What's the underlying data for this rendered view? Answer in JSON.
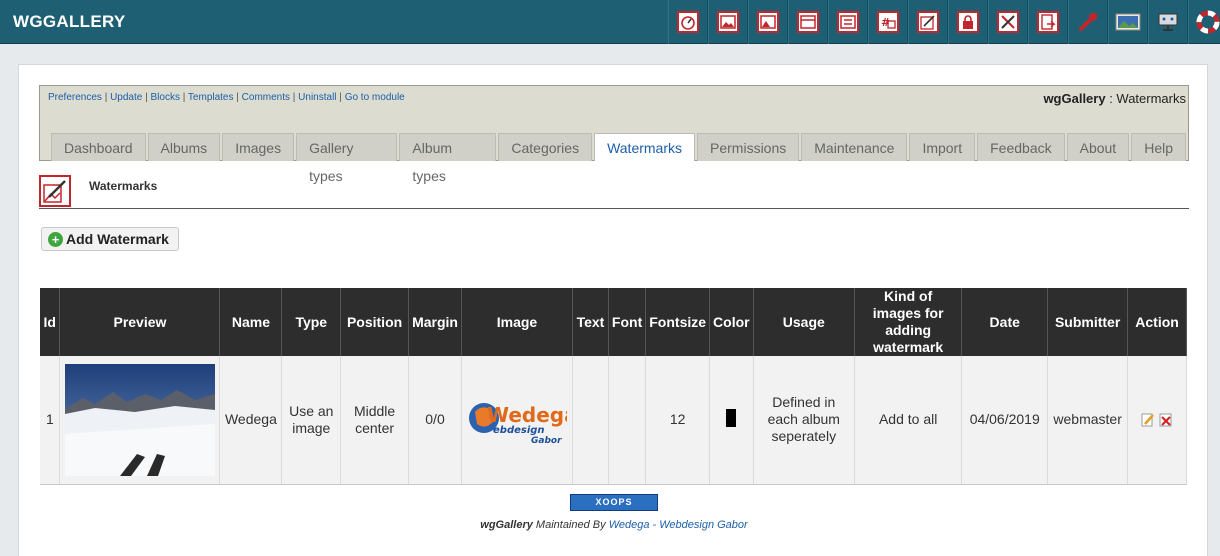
{
  "app": {
    "title": "WGGALLERY"
  },
  "toolbar": {
    "icons": [
      "dashboard-icon",
      "albums-icon",
      "images-icon",
      "gallery-types-icon",
      "album-types-icon",
      "categories-icon",
      "watermarks-icon",
      "permissions-icon",
      "maintenance-icon",
      "import-icon",
      "feedback-icon",
      "about-icon",
      "system-icon",
      "help-icon"
    ]
  },
  "module": {
    "links": [
      "Preferences",
      "Update",
      "Blocks",
      "Templates",
      "Comments",
      "Uninstall",
      "Go to module"
    ],
    "title_module": "wgGallery",
    "title_page": " : Watermarks",
    "tabs": [
      "Dashboard",
      "Albums",
      "Images",
      "Gallery types",
      "Album types",
      "Categories",
      "Watermarks",
      "Permissions",
      "Maintenance",
      "Import",
      "Feedback",
      "About",
      "Help"
    ],
    "active_tab": "Watermarks"
  },
  "section": {
    "title": "Watermarks"
  },
  "add_button": "Add Watermark",
  "table": {
    "headers": {
      "id": "Id",
      "preview": "Preview",
      "name": "Name",
      "type": "Type",
      "position": "Position",
      "margin": "Margin",
      "image": "Image",
      "text": "Text",
      "font": "Font",
      "fontsize": "Fontsize",
      "color": "Color",
      "usage": "Usage",
      "kind": "Kind of images for adding watermark",
      "date": "Date",
      "submitter": "Submitter",
      "action": "Action"
    },
    "row": {
      "id": "1",
      "name": "Wedega",
      "type": "Use an image",
      "position": "Middle center",
      "margin": "0/0",
      "text": "",
      "font": "",
      "fontsize": "12",
      "color": "#000000",
      "usage": "Defined in each album seperately",
      "kind": "Add to all",
      "date": "04/06/2019",
      "submitter": "webmaster",
      "watermark_logo_main": "Wedega",
      "watermark_logo_sub": "ebdesign",
      "watermark_logo_sub2": "Gabor"
    }
  },
  "footer": {
    "badge": "XOOPS",
    "module": "wgGallery",
    "maintained": " Maintained By ",
    "link": "Wedega - Webdesign Gabor"
  }
}
